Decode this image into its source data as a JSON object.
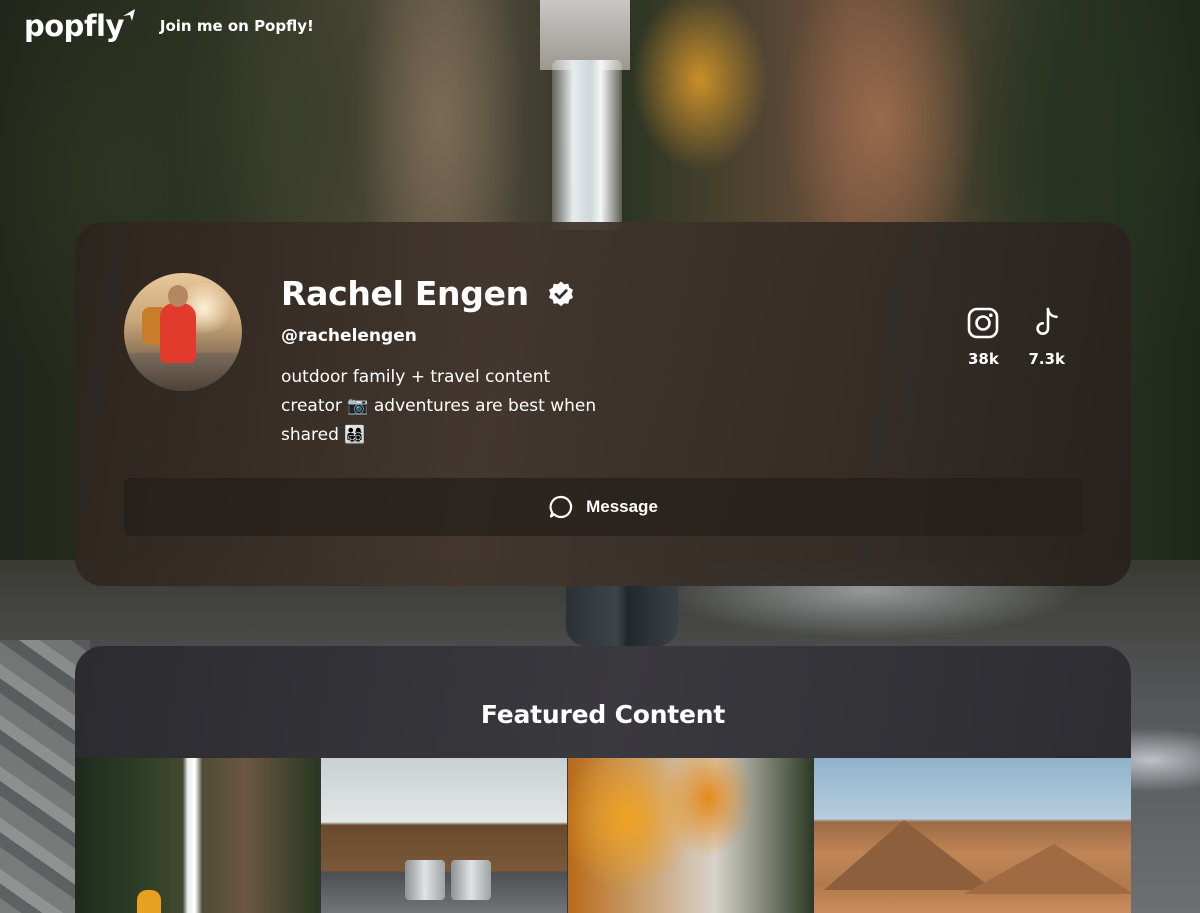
{
  "header": {
    "logo_text": "popfly",
    "join_text": "Join me on Popfly!"
  },
  "profile": {
    "name": "Rachel Engen",
    "handle": "@rachelengen",
    "bio_lines": [
      "outdoor family + travel content",
      "creator 📷 adventures are best when",
      "shared 👨‍👩‍👧‍👦"
    ],
    "avatar_icon": "avatar-photo",
    "verified_icon": "verified-badge-icon",
    "socials": [
      {
        "platform": "instagram",
        "icon": "instagram-icon",
        "count": "38k"
      },
      {
        "platform": "tiktok",
        "icon": "tiktok-icon",
        "count": "7.3k"
      }
    ],
    "message_label": "Message",
    "message_icon": "chat-bubble-icon"
  },
  "featured": {
    "title": "Featured Content"
  },
  "colors": {
    "text": "#ffffff",
    "card_bg": "#3a3029",
    "featured_bg": "#333237"
  }
}
